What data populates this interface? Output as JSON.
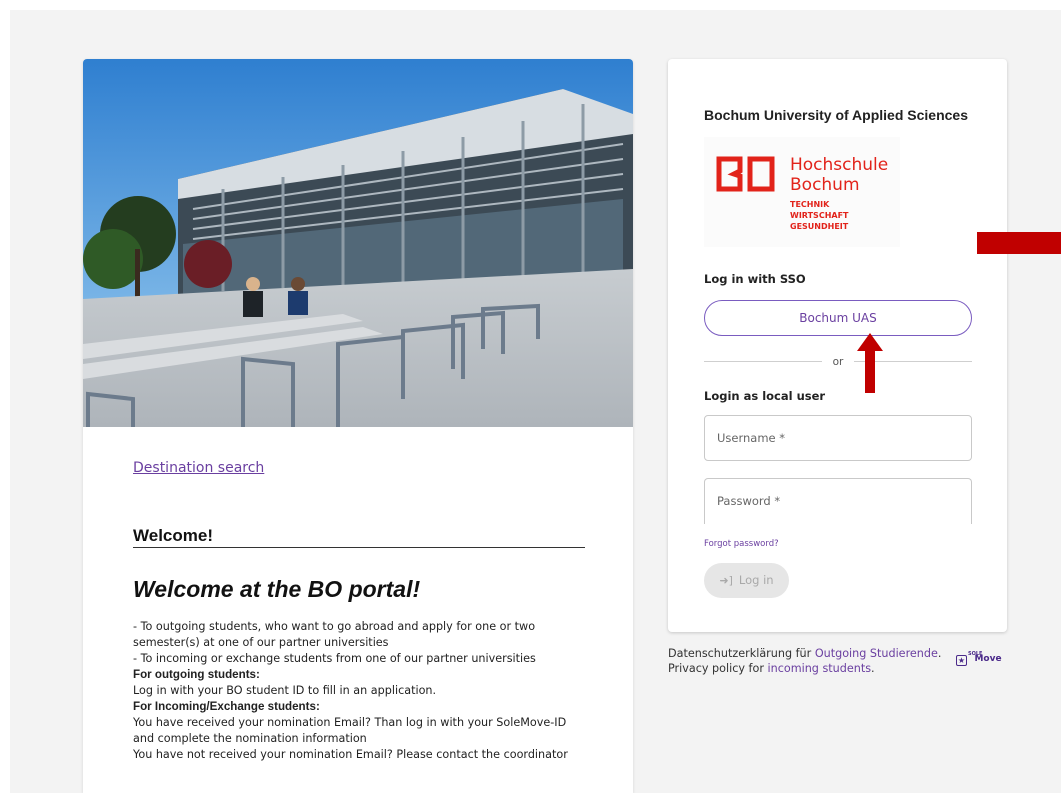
{
  "left": {
    "destination_link": "Destination search",
    "welcome_heading": "Welcome!",
    "welcome_title": "Welcome at the BO portal!",
    "intro_lines": [
      {
        "text": "- To outgoing students, who want to go abroad and apply for one or two semester(s) at one of our partner universities",
        "bold": false
      },
      {
        "text": "- To incoming or exchange students from one of our partner universities",
        "bold": false
      },
      {
        "text": "For outgoing students:",
        "bold": true
      },
      {
        "text": "Log in with your BO student ID to fill in an application.",
        "bold": false
      },
      {
        "text": "For Incoming/Exchange students:",
        "bold": true
      },
      {
        "text": " You have received your nomination Email? Than log in with your SoleMove-ID and complete the nomination information",
        "bold": false
      },
      {
        "text": "You have not received your nomination Email? Please contact the coordinator",
        "bold": false
      }
    ]
  },
  "login": {
    "university_name": "Bochum University of Applied Sciences",
    "logo": {
      "mark": "BO",
      "line1": "Hochschule",
      "line2": "Bochum",
      "sub1": "TECHNIK",
      "sub2": "WIRTSCHAFT",
      "sub3": "GESUNDHEIT",
      "color": "#e2231a"
    },
    "sso_label": "Log in with SSO",
    "sso_button": "Bochum UAS",
    "or_text": "or",
    "local_label": "Login as local user",
    "username_placeholder": "Username *",
    "password_placeholder": "Password *",
    "forgot_password": "Forgot password?",
    "login_button": "Log in",
    "login_icon": "sign-in-icon"
  },
  "footer": {
    "privacy_de_prefix": "Datenschutzerklärung für ",
    "privacy_de_link": "Outgoing Studierende",
    "privacy_de_suffix": ".",
    "privacy_en_prefix": "Privacy policy for ",
    "privacy_en_link": "incoming students",
    "privacy_en_suffix": ".",
    "solemove_brand": "Move",
    "solemove_small": "SOLE"
  },
  "colors": {
    "accent": "#6a3fa0",
    "annotation_red": "#c00000",
    "brand_red": "#e2231a"
  }
}
